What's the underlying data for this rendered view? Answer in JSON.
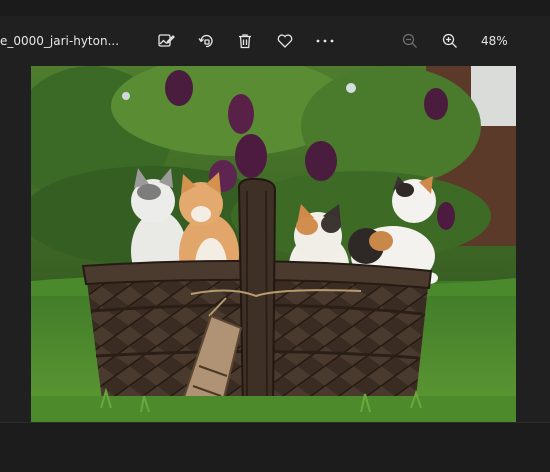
{
  "toolbar": {
    "filename": "e_0000_jari-hyton...",
    "zoom_level": "48%",
    "icons": [
      "edit-image-icon",
      "rotate-icon",
      "delete-icon",
      "favorite-icon",
      "more-icon",
      "zoom-out-icon",
      "zoom-in-icon"
    ]
  },
  "colors": {
    "background": "#202020",
    "toolbar_text": "#e6e6e6",
    "disabled_icon": "#6e6e6e"
  }
}
